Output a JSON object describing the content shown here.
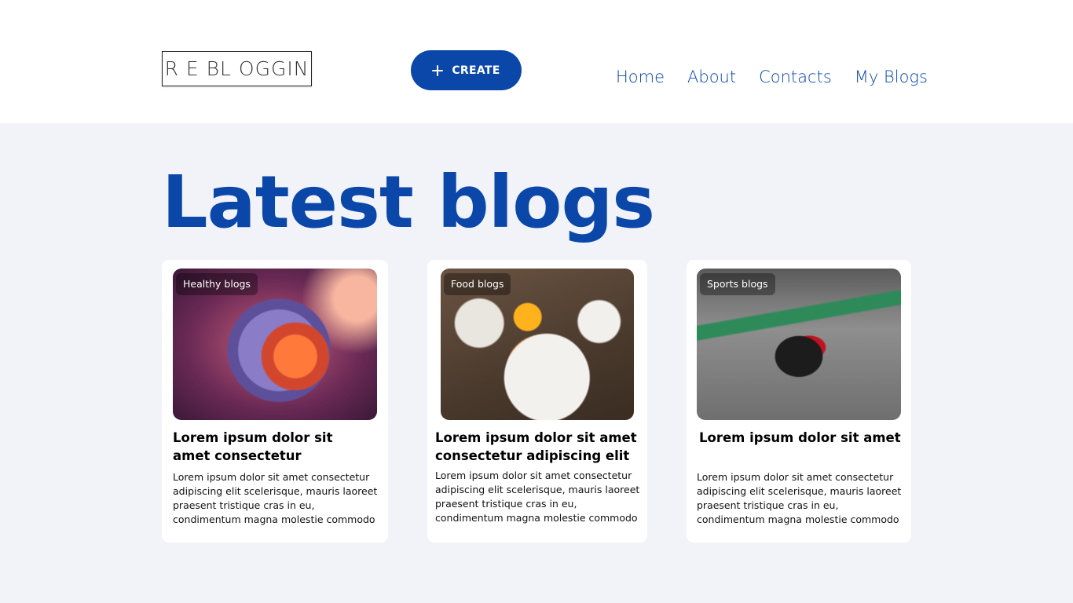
{
  "header": {
    "logo_text": "R E BL OGGIN",
    "create_label": "CREATE",
    "nav": [
      "Home",
      "About",
      "Contacts",
      "My Blogs"
    ]
  },
  "main": {
    "title": "Latest blogs",
    "cards": [
      {
        "badge": "Healthy blogs",
        "image": "virus-illustration",
        "title": "Lorem ipsum dolor sit amet consectetur",
        "text": "Lorem ipsum dolor sit amet consectetur adipiscing elit scelerisque, mauris laoreet praesent tristique cras in eu, condimentum magna molestie commodo"
      },
      {
        "badge": "Food blogs",
        "image": "breakfast-photo",
        "title": "Lorem ipsum dolor sit amet consectetur adipiscing elit",
        "text": "Lorem ipsum dolor sit amet consectetur adipiscing elit scelerisque, mauris laoreet praesent tristique cras in eu, condimentum magna molestie commodo"
      },
      {
        "badge": "Sports blogs",
        "image": "race-car-photo",
        "title": "Lorem ipsum dolor sit amet",
        "text": "Lorem ipsum dolor sit amet consectetur adipiscing elit scelerisque, mauris laoreet praesent tristique cras in eu, condimentum magna molestie commodo"
      }
    ]
  },
  "colors": {
    "accent": "#0a47a9",
    "background": "#f1f3f8",
    "card": "#ffffff"
  }
}
